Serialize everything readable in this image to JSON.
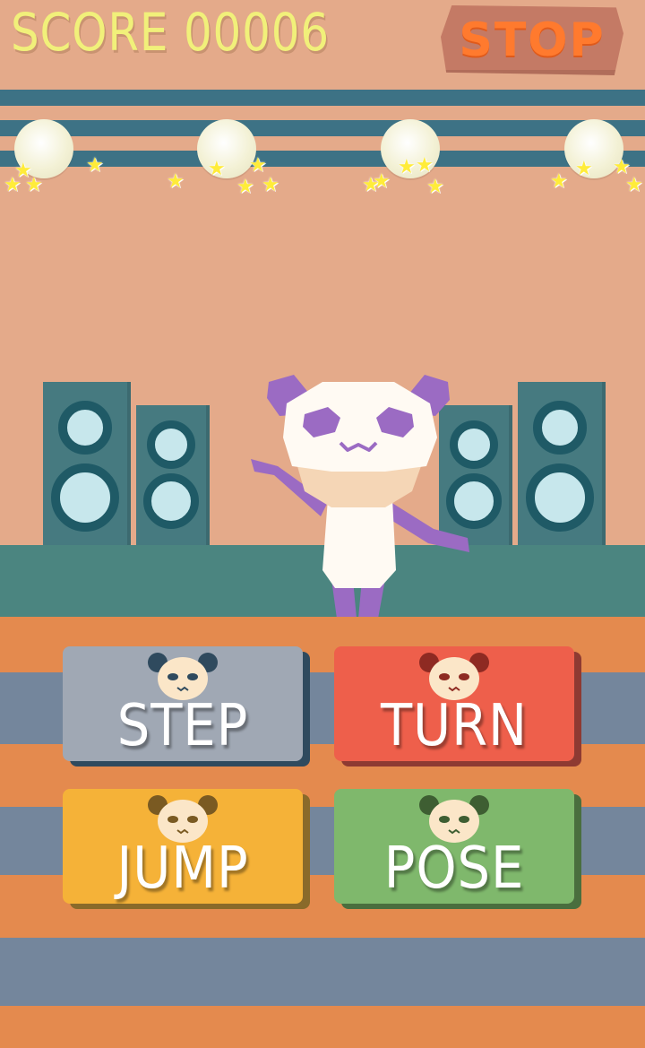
{
  "hud": {
    "score_label": "SCORE",
    "score_value": "00006",
    "stop_label": "STOP"
  },
  "controls": {
    "step_label": "STEP",
    "turn_label": "TURN",
    "jump_label": "JUMP",
    "pose_label": "POSE"
  },
  "colors": {
    "wall": "#e4aa8a",
    "stripe": "#3d7285",
    "platform": "#4b8580",
    "floor_orange": "#e48a4e",
    "floor_blue": "#74869c",
    "score_text": "#f1f07a",
    "stop_text": "#ff7a2e",
    "step": "#a0a8b4",
    "turn": "#ee5f4b",
    "jump": "#f5b238",
    "pose": "#7fb86c",
    "panda_accent": "#9b6bc3"
  },
  "icons": {
    "lights": "stage-light-icon",
    "sparkle": "star-icon",
    "button_face": "panda-face-icon"
  }
}
